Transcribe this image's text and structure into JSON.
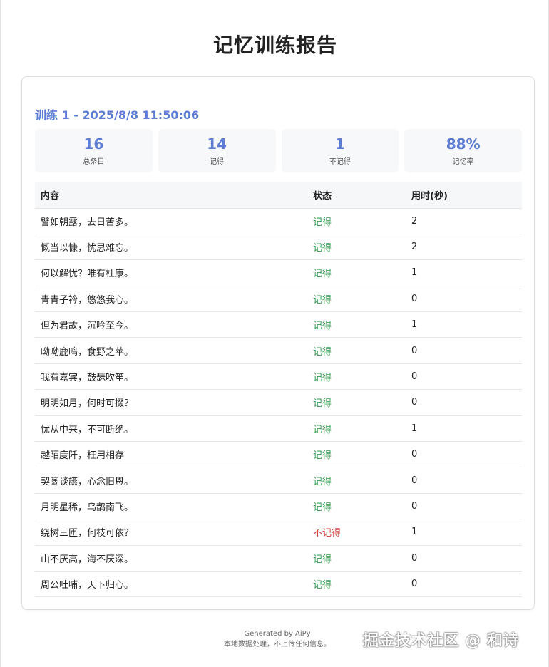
{
  "page": {
    "title": "记忆训练报告"
  },
  "session": {
    "title": "训练 1 - 2025/8/8 11:50:06"
  },
  "stats": [
    {
      "value": "16",
      "label": "总条目"
    },
    {
      "value": "14",
      "label": "记得"
    },
    {
      "value": "1",
      "label": "不记得"
    },
    {
      "value": "88%",
      "label": "记忆率"
    }
  ],
  "table": {
    "headers": [
      "内容",
      "状态",
      "用时(秒)"
    ],
    "rows": [
      {
        "content": "譬如朝露，去日苦多。",
        "status": "记得",
        "time": "2"
      },
      {
        "content": "慨当以慷，忧思难忘。",
        "status": "记得",
        "time": "2"
      },
      {
        "content": "何以解忧？唯有杜康。",
        "status": "记得",
        "time": "1"
      },
      {
        "content": "青青子衿，悠悠我心。",
        "status": "记得",
        "time": "0"
      },
      {
        "content": "但为君故，沉吟至今。",
        "status": "记得",
        "time": "1"
      },
      {
        "content": "呦呦鹿鸣，食野之苹。",
        "status": "记得",
        "time": "0"
      },
      {
        "content": "我有嘉宾，鼓瑟吹笙。",
        "status": "记得",
        "time": "0"
      },
      {
        "content": "明明如月，何时可掇？",
        "status": "记得",
        "time": "0"
      },
      {
        "content": "忧从中来，不可断绝。",
        "status": "记得",
        "time": "1"
      },
      {
        "content": "越陌度阡，枉用相存",
        "status": "记得",
        "time": "0"
      },
      {
        "content": "契阔谈讌，心念旧恩。",
        "status": "记得",
        "time": "0"
      },
      {
        "content": "月明星稀，乌鹊南飞。",
        "status": "记得",
        "time": "0"
      },
      {
        "content": "绕树三匝，何枝可依？",
        "status": "不记得",
        "time": "1"
      },
      {
        "content": "山不厌高，海不厌深。",
        "status": "记得",
        "time": "0"
      },
      {
        "content": "周公吐哺，天下归心。",
        "status": "记得",
        "time": "0"
      }
    ]
  },
  "footer": {
    "line1": "Generated by AiPy",
    "line2": "本地数据处理，不上传任何信息。"
  },
  "watermark": "掘金技术社区 @ 和诗",
  "colors": {
    "accent": "#5b7bd5",
    "remembered": "#2e9a4e",
    "forgotten": "#d23c3c"
  }
}
